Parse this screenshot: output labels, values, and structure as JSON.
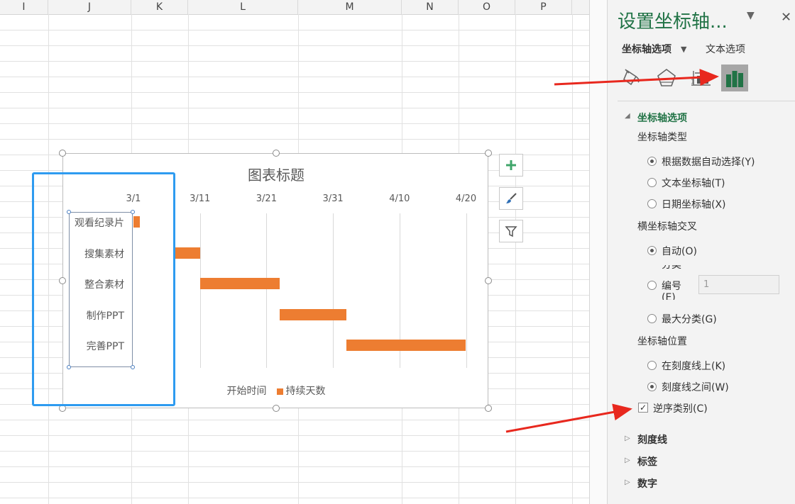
{
  "sheet": {
    "columns": [
      {
        "label": "I"
      },
      {
        "label": "J"
      },
      {
        "label": "K"
      },
      {
        "label": "L"
      },
      {
        "label": "M"
      },
      {
        "label": "N"
      },
      {
        "label": "O"
      },
      {
        "label": "P"
      }
    ]
  },
  "chart": {
    "title": "图表标题",
    "legend": {
      "series1": "开始时间",
      "series2": "持续天数"
    }
  },
  "chart_data": {
    "type": "bar",
    "orientation": "horizontal-stacked",
    "title": "图表标题",
    "categories": [
      "观看纪录片",
      "搜集素材",
      "整合素材",
      "制作PPT",
      "完善PPT"
    ],
    "x_tick_labels": [
      "3/1",
      "3/11",
      "3/21",
      "3/31",
      "4/10",
      "4/20"
    ],
    "xlim": [
      "3/1",
      "4/20"
    ],
    "series": [
      {
        "name": "开始时间",
        "values": [
          "2/23",
          "3/7",
          "3/11",
          "3/23",
          "4/2"
        ],
        "visible": false
      },
      {
        "name": "持续天数",
        "values": [
          7,
          4,
          12,
          10,
          18
        ],
        "color": "#ED7D31"
      }
    ],
    "legend": "bottom",
    "grid": "vertical"
  },
  "chart_buttons": {
    "add": "plus-icon",
    "style": "brush-icon",
    "filter": "filter-icon"
  },
  "pane": {
    "title": "设置坐标轴...",
    "tabs": {
      "axis_options": "坐标轴选项",
      "text_options": "文本选项"
    },
    "section_axis_options": "坐标轴选项",
    "axis_type_label": "坐标轴类型",
    "axis_type_options": [
      {
        "label": "根据数据自动选择(Y)",
        "selected": true
      },
      {
        "label": "文本坐标轴(T)",
        "selected": false
      },
      {
        "label": "日期坐标轴(X)",
        "selected": false
      }
    ],
    "cross_label": "横坐标轴交叉",
    "cross_auto": "自动(O)",
    "cross_cat_lines": [
      "分类",
      "编号",
      "(E)"
    ],
    "cross_cat_value": "1",
    "cross_max": "最大分类(G)",
    "position_label": "坐标轴位置",
    "position_options": [
      {
        "label": "在刻度线上(K)",
        "selected": false
      },
      {
        "label": "刻度线之间(W)",
        "selected": true
      }
    ],
    "reverse_label": "逆序类别(C)",
    "reverse_checked": true,
    "collapsed_sections": [
      "刻度线",
      "标签",
      "数字"
    ]
  },
  "colors": {
    "accent_green": "#217346",
    "bar_orange": "#ED7D31",
    "highlight_blue": "#2E9BF0",
    "arrow_red": "#E8281E"
  }
}
